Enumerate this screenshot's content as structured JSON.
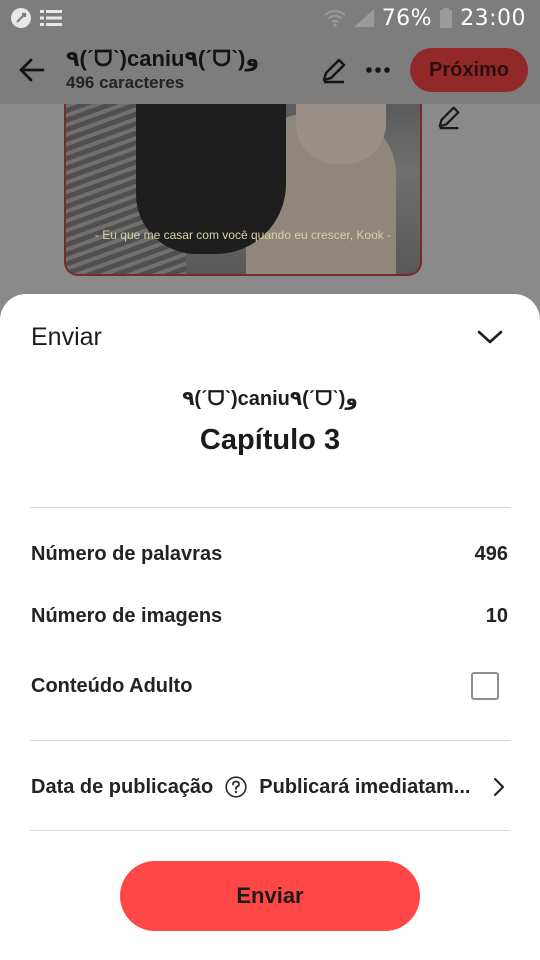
{
  "status_bar": {
    "battery": "76%",
    "time": "23:00",
    "icons": [
      "app-notification-icon",
      "list-notification-icon",
      "wifi-icon",
      "signal-icon",
      "battery-icon"
    ]
  },
  "header": {
    "story_title": "٩(ˊᗜˋ)caniu٩(ˊᗜˋ)و",
    "char_count": "496 caracteres",
    "next_label": "Próximo",
    "icons": [
      "back-arrow-icon",
      "pencil-icon",
      "more-dots-icon"
    ]
  },
  "background": {
    "image_caption": "- Eu que me casar com você quando eu crescer, Kook -",
    "icons": [
      "pencil-icon"
    ]
  },
  "sheet": {
    "title": "Enviar",
    "story_name": "٩(ˊᗜˋ)caniu٩(ˊᗜˋ)و",
    "chapter_title": "Capítulo 3",
    "words_label": "Número de palavras",
    "words_value": "496",
    "images_label": "Número de imagens",
    "images_value": "10",
    "adult_label": "Conteúdo Adulto",
    "adult_checked": false,
    "publish_label": "Data de publicação",
    "publish_value": "Publicará imediatam...",
    "send_label": "Enviar"
  },
  "colors": {
    "accent": "#ff4747",
    "dim_overlay": "#7d7d7d",
    "next_button": "#932828",
    "sheet_background": "#ffffff"
  }
}
